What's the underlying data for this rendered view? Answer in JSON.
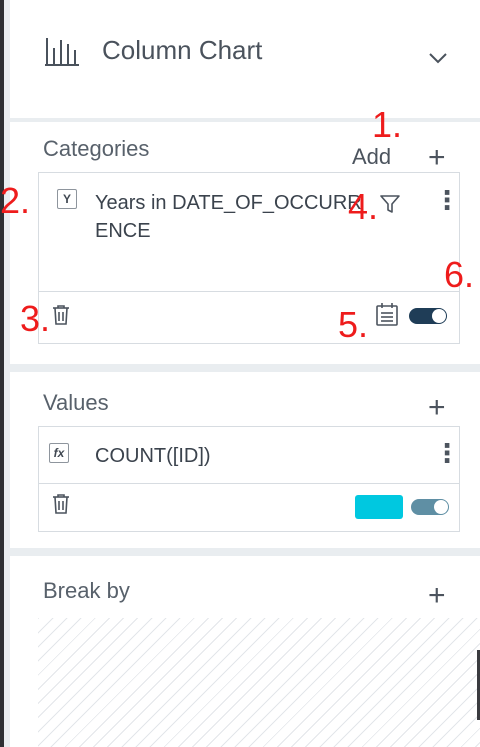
{
  "header": {
    "chart_type_label": "Column Chart",
    "chart_icon": "column-chart-icon",
    "dropdown_icon": "chevron-down-icon"
  },
  "categories": {
    "title": "Categories",
    "add_label": "Add",
    "add_icon": "+",
    "field": {
      "badge": "Y",
      "name": "Years in DATE_OF_OCCURRENCE",
      "kebab": "⋮"
    }
  },
  "values": {
    "title": "Values",
    "add_icon": "+",
    "field": {
      "badge": "fx",
      "name": "COUNT([ID])",
      "kebab": "⋮"
    },
    "color_swatch": "#00c8e0"
  },
  "break_by": {
    "title": "Break by",
    "add_icon": "+"
  },
  "annotations": [
    "1.",
    "2.",
    "3.",
    "4.",
    "5.",
    "6."
  ],
  "colors": {
    "toggle_on": "#1f3d57",
    "toggle_values": "#5f8fa4",
    "annotation": "#ee1c1c"
  }
}
